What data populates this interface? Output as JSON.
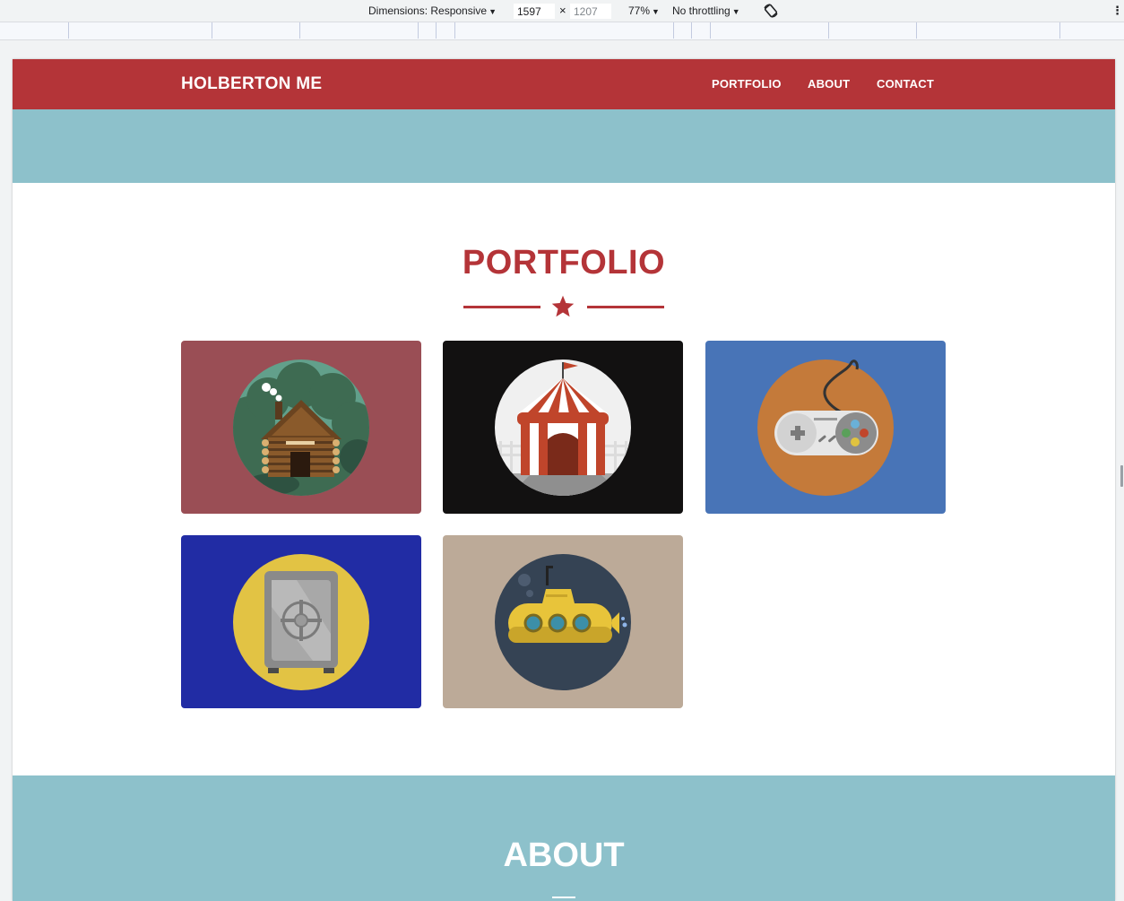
{
  "devtools": {
    "dimensions_label": "Dimensions: Responsive",
    "width_value": "1597",
    "height_placeholder": "1207",
    "times": "×",
    "zoom": "77%",
    "throttling": "No throttling"
  },
  "site": {
    "brand": "HOLBERTON ME",
    "nav": [
      {
        "label": "PORTFOLIO"
      },
      {
        "label": "ABOUT"
      },
      {
        "label": "CONTACT"
      }
    ],
    "portfolio_title": "PORTFOLIO",
    "about_title": "ABOUT",
    "portfolio_items": [
      {
        "icon": "cabin-icon",
        "bg": "#9a4e55"
      },
      {
        "icon": "circus-tent-icon",
        "bg": "#121111"
      },
      {
        "icon": "game-controller-icon",
        "bg": "#4874b7"
      },
      {
        "icon": "safe-icon",
        "bg": "#212ca4"
      },
      {
        "icon": "submarine-icon",
        "bg": "#bcaa98"
      }
    ]
  },
  "colors": {
    "primary": "#b43438",
    "secondary": "#8dc1cb"
  }
}
